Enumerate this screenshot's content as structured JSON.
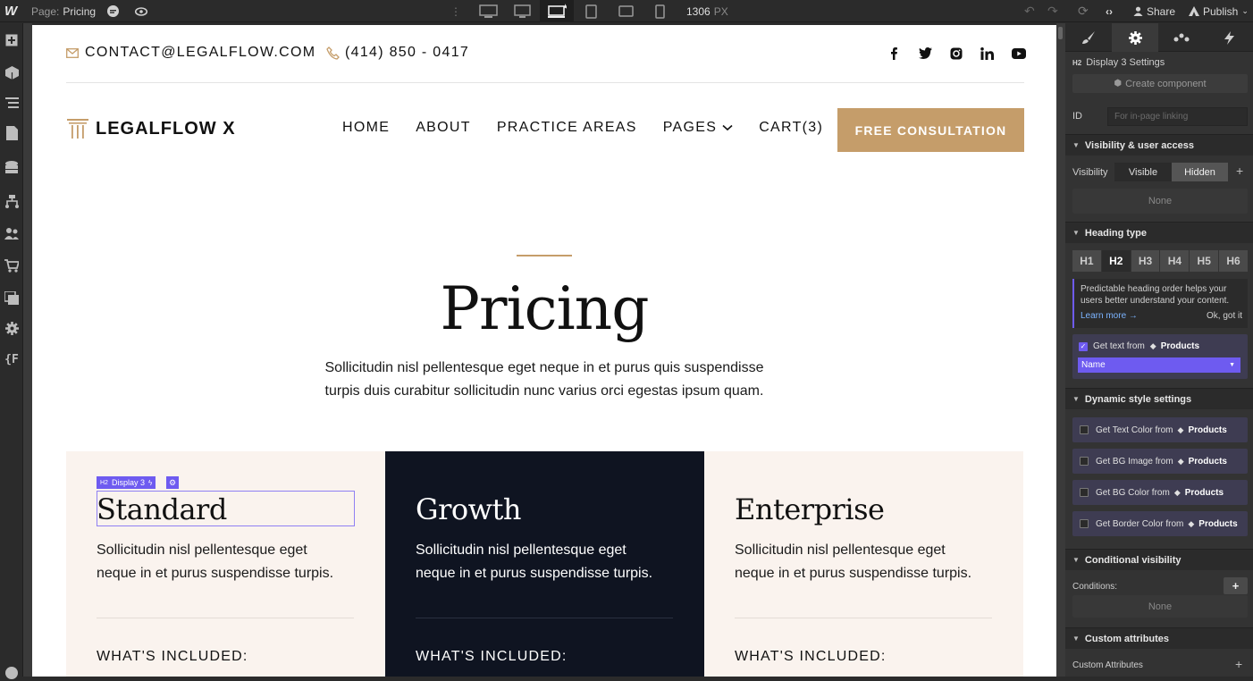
{
  "topbar": {
    "logo": "W",
    "page_label": "Page:",
    "page_name": "Pricing",
    "width_value": "1306",
    "width_unit": "PX",
    "share_label": "Share",
    "publish_label": "Publish"
  },
  "site": {
    "email": "CONTACT@LEGALFLOW.COM",
    "phone": "(414) 850 - 0417",
    "brand": "LEGALFLOW X",
    "nav": {
      "home": "HOME",
      "about": "ABOUT",
      "practice": "PRACTICE AREAS",
      "pages": "PAGES",
      "cart": "CART(3)"
    },
    "cta": "FREE CONSULTATION",
    "hero_title": "Pricing",
    "hero_text_1": "Sollicitudin nisl pellentesque eget neque in et purus quis suspendisse",
    "hero_text_2": "turpis duis curabitur sollicitudin nunc varius orci egestas ipsum quam.",
    "selection_label": "Display 3",
    "selection_tag": "H2",
    "plans": [
      {
        "name": "Standard",
        "text_1": "Sollicitudin nisl pellentesque eget",
        "text_2": "neque in et purus suspendisse turpis.",
        "included": "WHAT'S INCLUDED:"
      },
      {
        "name": "Growth",
        "text_1": "Sollicitudin nisl pellentesque eget",
        "text_2": "neque in et purus suspendisse turpis.",
        "included": "WHAT'S INCLUDED:"
      },
      {
        "name": "Enterprise",
        "text_1": "Sollicitudin nisl pellentesque eget",
        "text_2": "neque in et purus suspendisse turpis.",
        "included": "WHAT'S INCLUDED:"
      }
    ]
  },
  "panel": {
    "element_tag": "H2",
    "element_title": "Display 3 Settings",
    "create_component": "Create component",
    "id_label": "ID",
    "id_placeholder": "For in-page linking",
    "visibility_section": "Visibility & user access",
    "visibility_label": "Visibility",
    "visible": "Visible",
    "hidden": "Hidden",
    "none": "None",
    "heading_section": "Heading type",
    "headings": [
      "H1",
      "H2",
      "H3",
      "H4",
      "H5",
      "H6"
    ],
    "hint_text": "Predictable heading order helps your users better understand your content.",
    "learn_more": "Learn more →",
    "ok_got_it": "Ok, got it",
    "get_text_from": "Get text from",
    "products": "Products",
    "name_option": "Name",
    "dynamic_section": "Dynamic style settings",
    "dyn_text_color": "Get Text Color from",
    "dyn_bg_image": "Get BG Image from",
    "dyn_bg_color": "Get BG Color from",
    "dyn_border_color": "Get Border Color from",
    "conditional_section": "Conditional visibility",
    "conditions_label": "Conditions:",
    "conditions_none": "None",
    "custom_attr_section": "Custom attributes",
    "custom_attr_label": "Custom Attributes"
  },
  "colors": {
    "gold": "#c59d6a",
    "navy": "#0f1421",
    "cream": "#faf3ee",
    "accent": "#6e5bf0"
  }
}
